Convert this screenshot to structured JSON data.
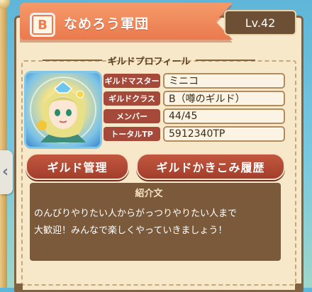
{
  "guild": {
    "rank": "B",
    "name": "なめろう軍団",
    "level": "Lv.42"
  },
  "profile": {
    "section_title": "ギルドプロフィール",
    "rows": [
      {
        "label": "ギルドマスター",
        "value": "ミニコ"
      },
      {
        "label": "ギルドクラス",
        "value": "B（噂のギルド）"
      },
      {
        "label": "メンバー",
        "value": "44/45"
      },
      {
        "label": "トータルTP",
        "value": "5912340TP"
      }
    ]
  },
  "buttons": {
    "manage": "ギルド管理",
    "board_history": "ギルドかきこみ履歴"
  },
  "intro": {
    "title": "紹介文",
    "line1": "のんびりやりたい人からがっつりやりたい人まで",
    "line2": "大歓迎！みんなで楽しくやっていきましょう！"
  },
  "icons": {
    "left_arrow": "chevron-left-icon",
    "rank": "rank-badge-icon"
  },
  "colors": {
    "banner": "#ea7a4d",
    "button": "#a23e2c",
    "panel": "#f6e8c8"
  }
}
